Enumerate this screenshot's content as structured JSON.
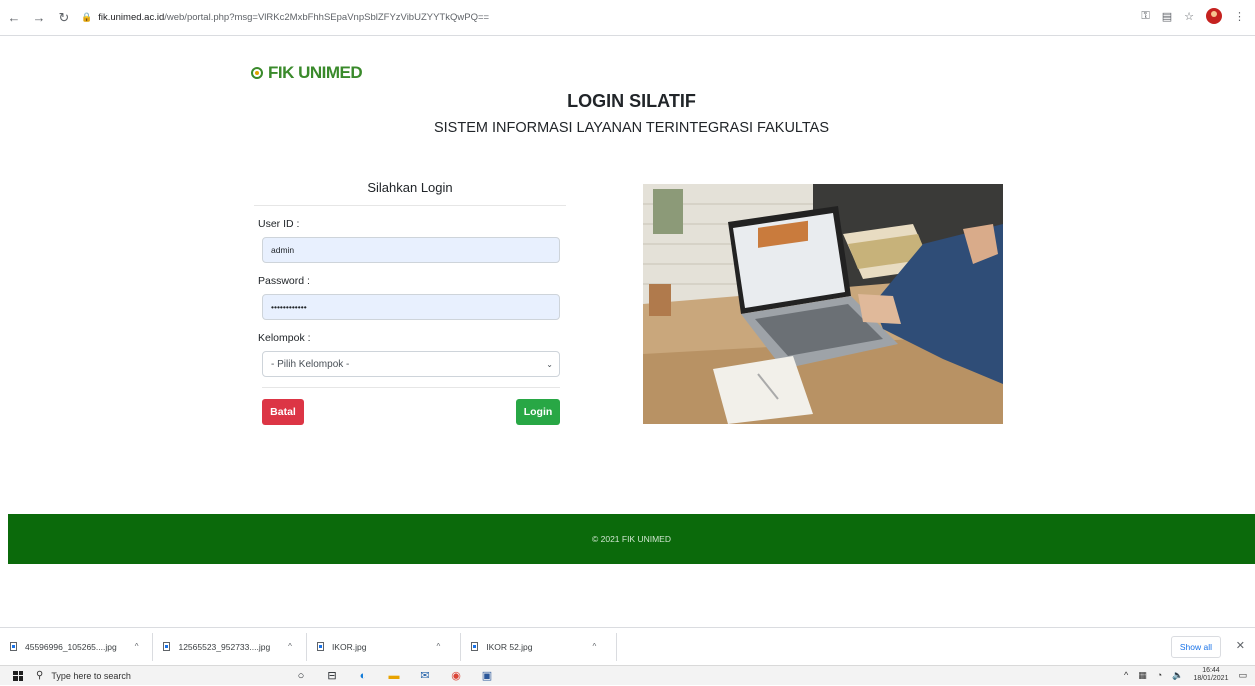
{
  "browser": {
    "url_host": "fik.unimed.ac.id",
    "url_path": "/web/portal.php?msg=VlRKc2MxbFhhSEpaVnpSblZFYzVibUZYYTkQwPQ=="
  },
  "header": {
    "logo_text": "FIK UNIMED",
    "title": "LOGIN SILATIF",
    "subtitle": "SISTEM INFORMASI LAYANAN TERINTEGRASI FAKULTAS"
  },
  "login_form": {
    "heading": "Silahkan Login",
    "userid_label": "User ID :",
    "userid_value": "admin",
    "password_label": "Password :",
    "password_value": "••••••••••••",
    "group_label": "Kelompok :",
    "group_selected": "- Pilih Kelompok -",
    "cancel_label": "Batal",
    "login_label": "Login"
  },
  "footer": {
    "copyright": "© 2021 FIK UNIMED"
  },
  "downloads": {
    "items": [
      {
        "name": "45596996_105265....jpg"
      },
      {
        "name": "12565523_952733....jpg"
      },
      {
        "name": "IKOR.jpg"
      },
      {
        "name": "IKOR 52.jpg"
      }
    ],
    "show_all": "Show all"
  },
  "taskbar": {
    "search_placeholder": "Type here to search",
    "time": "16:44",
    "date": "18/01/2021"
  },
  "colors": {
    "footer_green": "#0b6a0b",
    "logo_green": "#3a8a2b",
    "danger": "#dc3545",
    "success": "#28a745"
  }
}
